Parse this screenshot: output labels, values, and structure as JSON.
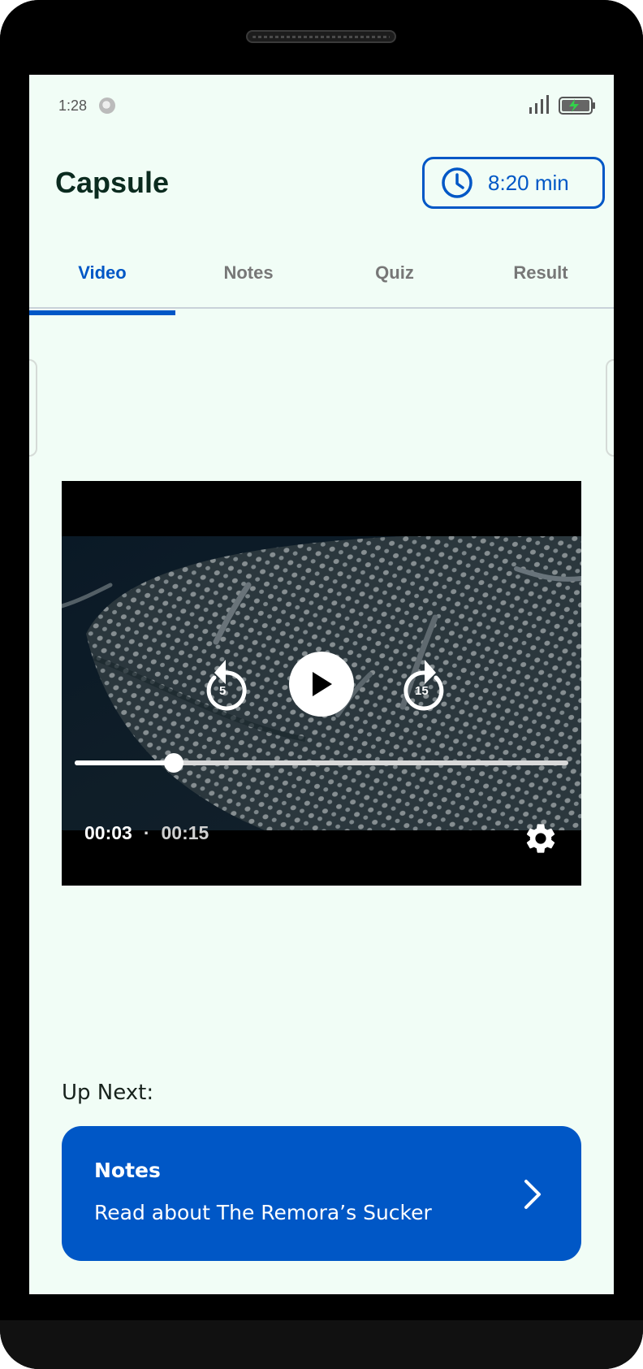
{
  "status_bar": {
    "time": "1:28"
  },
  "header": {
    "title": "Capsule",
    "timer_label": "8:20 min"
  },
  "tabs": [
    {
      "label": "Video",
      "active": true
    },
    {
      "label": "Notes",
      "active": false
    },
    {
      "label": "Quiz",
      "active": false
    },
    {
      "label": "Result",
      "active": false
    }
  ],
  "player": {
    "rewind_seconds": "5",
    "forward_seconds": "15",
    "current_time": "00:03",
    "separator": "·",
    "total_time": "00:15",
    "progress_fraction": 0.2
  },
  "up_next": {
    "label": "Up Next:",
    "card_title": "Notes",
    "card_subtitle": "Read about The Remora’s Sucker"
  },
  "colors": {
    "accent": "#0057c6",
    "screen_bg": "#f1fdf6"
  }
}
